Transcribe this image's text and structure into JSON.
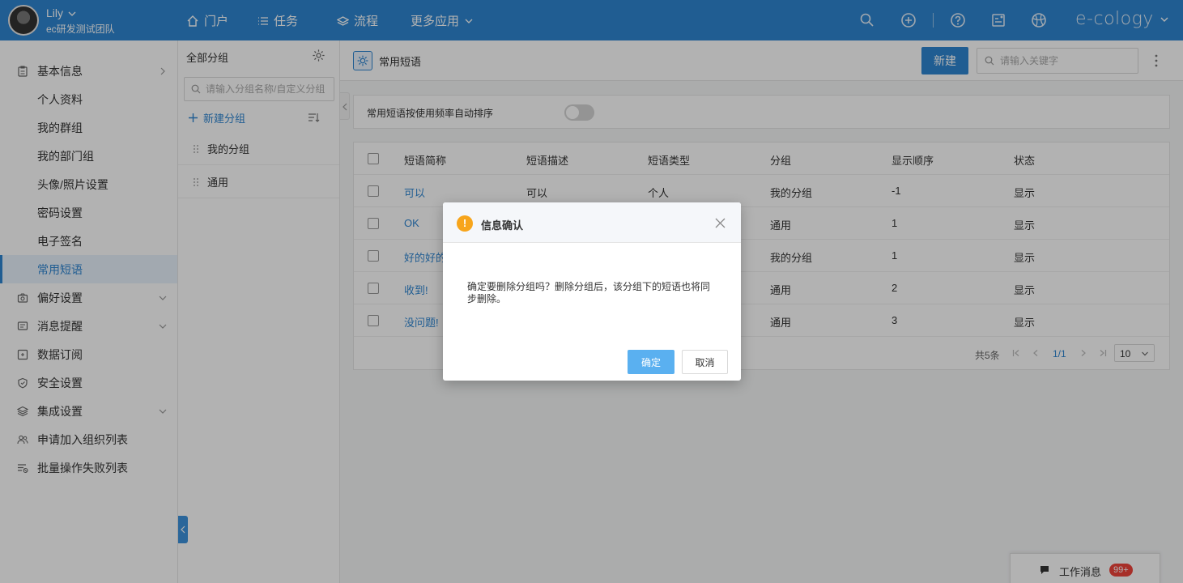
{
  "user": {
    "name": "Lily",
    "team": "ec研发测试团队"
  },
  "nav": [
    {
      "label": "门户",
      "icon": "home-icon"
    },
    {
      "label": "任务",
      "icon": "list-icon"
    },
    {
      "label": "流程",
      "icon": "layers-icon"
    },
    {
      "label": "更多应用",
      "icon": "chevron-down-icon"
    }
  ],
  "brand": "e-cology",
  "sidebar": {
    "items": [
      {
        "label": "基本信息",
        "icon": "clipboard-icon",
        "arrow": "right"
      },
      {
        "label": "个人资料"
      },
      {
        "label": "我的群组"
      },
      {
        "label": "我的部门组"
      },
      {
        "label": "头像/照片设置"
      },
      {
        "label": "密码设置"
      },
      {
        "label": "电子签名"
      },
      {
        "label": "常用短语",
        "active": true
      },
      {
        "label": "偏好设置",
        "icon": "camera-icon",
        "arrow": "down"
      },
      {
        "label": "消息提醒",
        "icon": "message-icon",
        "arrow": "down"
      },
      {
        "label": "数据订阅",
        "icon": "subscribe-icon"
      },
      {
        "label": "安全设置",
        "icon": "shield-icon"
      },
      {
        "label": "集成设置",
        "icon": "stack-icon",
        "arrow": "down"
      },
      {
        "label": "申请加入组织列表",
        "icon": "users-icon"
      },
      {
        "label": "批量操作失败列表",
        "icon": "failed-list-icon"
      }
    ]
  },
  "groups": {
    "title": "全部分组",
    "search_placeholder": "请输入分组名称/自定义分组",
    "new_label": "新建分组",
    "items": [
      "我的分组",
      "通用"
    ]
  },
  "main": {
    "title": "常用短语",
    "new_button": "新建",
    "search_placeholder": "请输入关键字",
    "auto_sort_label": "常用短语按使用频率自动排序",
    "auto_sort_on": false
  },
  "table": {
    "headers": [
      "短语简称",
      "短语描述",
      "短语类型",
      "分组",
      "显示顺序",
      "状态"
    ],
    "rows": [
      [
        "可以",
        "可以",
        "个人",
        "我的分组",
        "-1",
        "显示"
      ],
      [
        "OK",
        "",
        "",
        "通用",
        "1",
        "显示"
      ],
      [
        "好的好的",
        "",
        "",
        "我的分组",
        "1",
        "显示"
      ],
      [
        "收到!",
        "",
        "",
        "通用",
        "2",
        "显示"
      ],
      [
        "没问题!",
        "",
        "",
        "通用",
        "3",
        "显示"
      ]
    ]
  },
  "pager": {
    "total": "共5条",
    "page": "1/1",
    "size": "10"
  },
  "work_msg": {
    "label": "工作消息",
    "badge": "99+"
  },
  "dialog": {
    "title": "信息确认",
    "body": "确定要删除分组吗？删除分组后，该分组下的短语也将同步删除。",
    "ok": "确定",
    "cancel": "取消"
  },
  "colors": {
    "primary": "#2f86d2",
    "warning": "#f7a51b",
    "badge": "#f0443c"
  }
}
